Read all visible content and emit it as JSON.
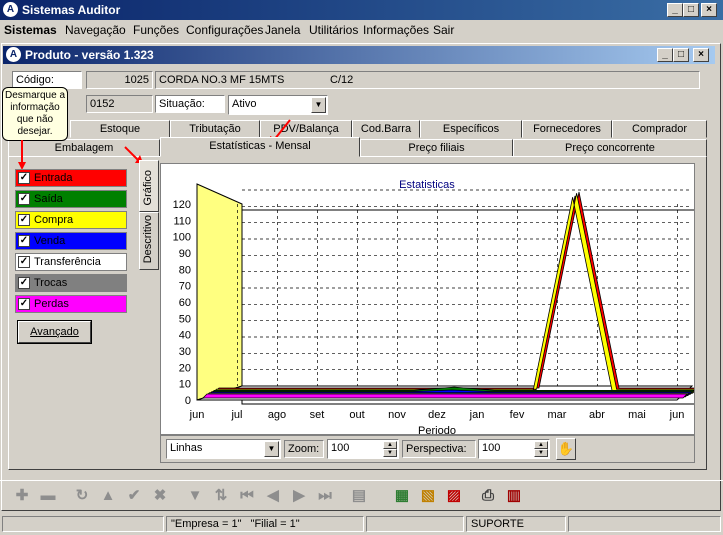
{
  "app": {
    "title": "Sistemas Auditor",
    "icon_letter": "A"
  },
  "menu": [
    "Sistemas",
    "Navegação",
    "Funções",
    "Configurações",
    "Janela",
    "Utilitários",
    "Informações",
    "Sair"
  ],
  "window": {
    "title": "Produto - versão 1.323"
  },
  "form": {
    "codigo_label": "Código:",
    "codigo_value": "1025",
    "descricao_value": "CORDA NO.3 MF 15MTS",
    "unidade_value": "C/12",
    "secao_value": "0152",
    "situacao_label": "Situação:",
    "situacao_value": "Ativo"
  },
  "tooltip": "Desmarque a informação que não desejar.",
  "tabs_row1": [
    "Estoque",
    "Tributação",
    "PDV/Balança",
    "Cod.Barra",
    "Específicos",
    "Fornecedores",
    "Comprador"
  ],
  "tabs_row2": [
    "Embalagem",
    "Estatísticas - Mensal",
    "Preço filiais",
    "Preço concorrente"
  ],
  "vertical_tabs": [
    "Gráfico",
    "Descritivo"
  ],
  "legend": [
    {
      "label": "Entrada",
      "color": "#ff0000",
      "text_color": "#000000"
    },
    {
      "label": "Saída",
      "color": "#008000",
      "text_color": "#000000"
    },
    {
      "label": "Compra",
      "color": "#ffff00",
      "text_color": "#000000"
    },
    {
      "label": "Venda",
      "color": "#0000ff",
      "text_color": "#000000"
    },
    {
      "label": "Transferência",
      "color": "#ffffff",
      "text_color": "#000000"
    },
    {
      "label": "Trocas",
      "color": "#808080",
      "text_color": "#000000"
    },
    {
      "label": "Perdas",
      "color": "#ff00ff",
      "text_color": "#000000"
    }
  ],
  "advanced_button": "Avançado",
  "chart_controls": {
    "type_value": "Linhas",
    "zoom_label": "Zoom:",
    "zoom_value": "100",
    "perspective_label": "Perspectiva:",
    "perspective_value": "100"
  },
  "status": {
    "empresa": "\"Empresa = 1\"",
    "filial": "\"Filial = 1\"",
    "user": "SUPORTE"
  },
  "chart_data": {
    "type": "line",
    "title": "Estatisticas",
    "xlabel": "Periodo",
    "ylabel": "",
    "categories": [
      "jun",
      "jul",
      "ago",
      "set",
      "out",
      "nov",
      "dez",
      "jan",
      "fev",
      "mar",
      "abr",
      "mai",
      "jun"
    ],
    "ylim": [
      0,
      120
    ],
    "yticks": [
      0,
      10,
      20,
      30,
      40,
      50,
      60,
      70,
      80,
      90,
      100,
      110,
      120
    ],
    "grid": true,
    "series": [
      {
        "color": "#ff0000",
        "values": [
          0,
          0,
          0,
          0,
          0,
          0,
          0,
          0,
          0,
          120,
          0,
          0,
          0
        ]
      },
      {
        "color": "#ffff00",
        "values": [
          0,
          0,
          0,
          0,
          0,
          0,
          0,
          0,
          0,
          120,
          0,
          0,
          0
        ]
      },
      {
        "color": "#008000",
        "values": [
          0,
          0,
          0,
          0,
          0,
          0,
          2,
          0,
          0,
          0,
          0,
          0,
          0
        ]
      },
      {
        "color": "#0000ff",
        "values": [
          0,
          0,
          0,
          0,
          0,
          0,
          1,
          0,
          0,
          0,
          0,
          0,
          0
        ]
      },
      {
        "color": "#808080",
        "values": [
          0,
          0,
          0,
          0,
          0,
          0,
          0,
          0,
          0,
          0,
          0,
          0,
          0
        ]
      },
      {
        "color": "#ff00ff",
        "values": [
          0,
          0,
          0,
          0,
          0,
          0,
          0,
          0,
          0,
          0,
          0,
          0,
          0
        ]
      }
    ]
  }
}
